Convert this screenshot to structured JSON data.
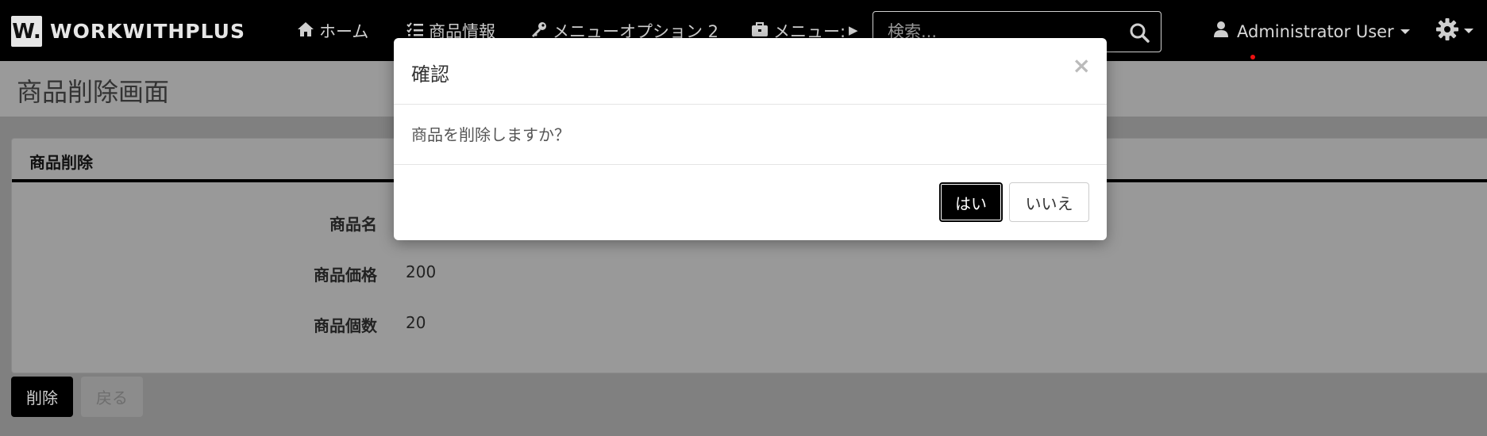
{
  "navbar": {
    "brand_logo": "W.",
    "brand_name": "WORKWITHPLUS",
    "items": [
      {
        "label": "ホーム",
        "icon": "home-icon"
      },
      {
        "label": "商品情報",
        "icon": "list-icon"
      },
      {
        "label": "メニューオプション 2",
        "icon": "key-icon"
      },
      {
        "label": "メニュー:",
        "icon": "briefcase-icon"
      }
    ],
    "overflow_arrow": "▶",
    "search_placeholder": "検索...",
    "user_name": "Administrator User"
  },
  "page": {
    "title": "商品削除画面",
    "panel_title": "商品削除",
    "fields": [
      {
        "label": "商品名",
        "value": ""
      },
      {
        "label": "商品価格",
        "value": "200"
      },
      {
        "label": "商品個数",
        "value": "20"
      }
    ],
    "delete_button": "削除",
    "back_button": "戻る"
  },
  "modal": {
    "title": "確認",
    "close_symbol": "×",
    "message": "商品を削除しますか？",
    "yes_button": "はい",
    "no_button": "いいえ"
  },
  "colors": {
    "navbar_bg": "#000000",
    "overlay_bg": "#808080",
    "primary_button": "#000000"
  }
}
